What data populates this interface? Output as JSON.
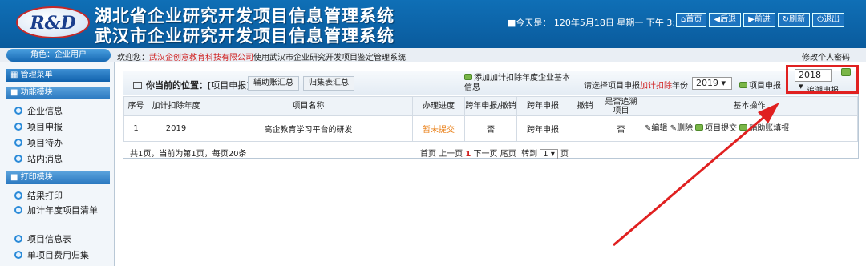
{
  "header": {
    "logo_text": "R&D",
    "title_line1": "湖北省企业研究开发项目信息管理系统",
    "title_line2": "武汉市企业研究开发项目信息管理系统",
    "today_label": "■今天是：",
    "today_value": "120年5月18日 星期一 下午 3:28:11",
    "nav": [
      "首页",
      "后退",
      "前进",
      "刷新",
      "退出"
    ]
  },
  "topbar": {
    "role": "角色：企业用户",
    "welcome_prefix": "欢迎您：",
    "company": "武汉企创意教育科技有限公司",
    "welcome_suffix": "使用武汉市企业研究开发项目鉴定管理系统",
    "change_info": "修改个人密码"
  },
  "sidebar": {
    "title": "管理菜单",
    "sections": [
      {
        "title": "功能模块",
        "items": [
          "企业信息",
          "项目申报",
          "项目待办",
          "站内消息"
        ]
      },
      {
        "title": "打印模块",
        "items": [
          "结果打印",
          "加计年度项目清单",
          "项目信息表",
          "单项目费用归集"
        ]
      }
    ]
  },
  "toolbar": {
    "location_label": "你当前的位置：",
    "location_value": "[项目申报]",
    "btn_aux": "辅助账汇总",
    "btn_summary": "归集表汇总",
    "add_base_info": "添加加计扣除年度企业基本信息",
    "select_prefix": "请选择项目申报",
    "select_highlight": "加计扣除",
    "select_suffix": "年份",
    "year_selected": "2019",
    "project_apply": "项目申报",
    "trace_year": "2018",
    "trace_apply": "追溯申报"
  },
  "table": {
    "headers": [
      "序号",
      "加计扣除年度",
      "项目名称",
      "办理进度",
      "跨年申报/撤销",
      "跨年申报",
      "撤销",
      "是否追溯项目",
      "基本操作"
    ],
    "rows": [
      {
        "no": "1",
        "year": "2019",
        "name": "高企教育学习平台的研发",
        "status": "暂未提交",
        "cross_cancel": "否",
        "cross": "跨年申报",
        "cancel": "",
        "trace": "否",
        "ops": [
          "编辑",
          "删除",
          "项目提交",
          "辅助账填报"
        ]
      }
    ]
  },
  "footer": {
    "summary": "共1页，当前为第1页，每页20条",
    "first": "首页",
    "prev": "上一页",
    "current": "1",
    "next": "下一页",
    "last": "尾页",
    "goto_label": "转到",
    "goto_value": "1",
    "page_unit": "页"
  },
  "colors": {
    "accent": "#0f6fb6",
    "highlight": "#e02020",
    "status": "#e8780a"
  }
}
